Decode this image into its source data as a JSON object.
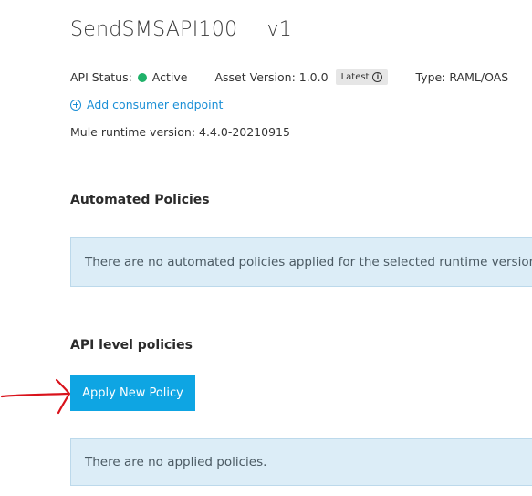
{
  "api": {
    "name": "SendSMSAPI100",
    "version": "v1"
  },
  "meta": {
    "status_label": "API Status:",
    "status_value": "Active",
    "status_color": "#1fb169",
    "asset_version_label": "Asset Version: 1.0.0",
    "latest_badge": "Latest",
    "badge_icon": "info-icon",
    "type_label": "Type: RAML/OAS"
  },
  "add_endpoint": {
    "label": "Add consumer endpoint",
    "icon": "plus-circle-icon"
  },
  "runtime": {
    "text": "Mule runtime version: 4.4.0-20210915"
  },
  "automated_policies": {
    "heading": "Automated Policies",
    "message": "There are no automated policies applied for the selected runtime version."
  },
  "api_policies": {
    "heading": "API level policies",
    "apply_button": "Apply New Policy",
    "message": "There are no applied policies."
  },
  "colors": {
    "accent": "#0ea5e3",
    "link": "#1b8fd6",
    "info_bg": "#dcedf7",
    "annotation_arrow": "#d9121b"
  }
}
